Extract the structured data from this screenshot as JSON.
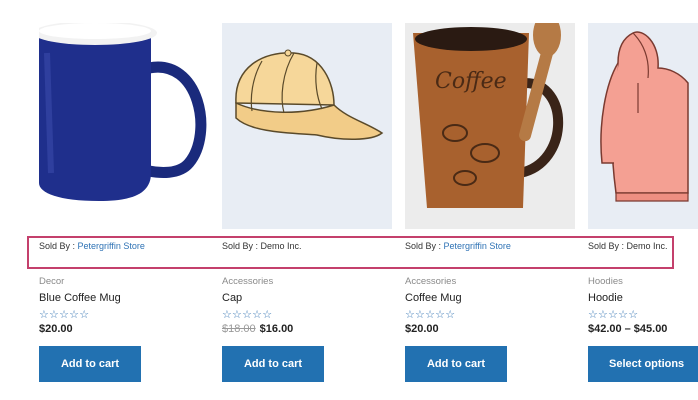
{
  "highlight_color": "#c4406c",
  "accent_color": "#2271b1",
  "star_glyphs": "☆☆☆☆☆",
  "products": [
    {
      "sold_by_label": "Sold By : ",
      "vendor": "Petergriffin Store",
      "vendor_is_link": true,
      "category": "Decor",
      "name": "Blue Coffee Mug",
      "price": "$20.00",
      "regular_price": "",
      "button": "Add to cart",
      "image": "blue-mug-icon"
    },
    {
      "sold_by_label": "Sold By : ",
      "vendor": "Demo Inc.",
      "vendor_is_link": false,
      "category": "Accessories",
      "name": "Cap",
      "price": "$16.00",
      "regular_price": "$18.00",
      "button": "Add to cart",
      "image": "cap-icon"
    },
    {
      "sold_by_label": "Sold By : ",
      "vendor": "Petergriffin Store",
      "vendor_is_link": true,
      "category": "Accessories",
      "name": "Coffee Mug",
      "price": "$20.00",
      "regular_price": "",
      "button": "Add to cart",
      "image": "coffee-mug-icon"
    },
    {
      "sold_by_label": "Sold By : ",
      "vendor": "Demo Inc.",
      "vendor_is_link": false,
      "category": "Hoodies",
      "name": "Hoodie",
      "price_min": "$42.00",
      "price_sep": "–",
      "price_max": "$45.00",
      "button": "Select options",
      "image": "hoodie-icon"
    }
  ]
}
